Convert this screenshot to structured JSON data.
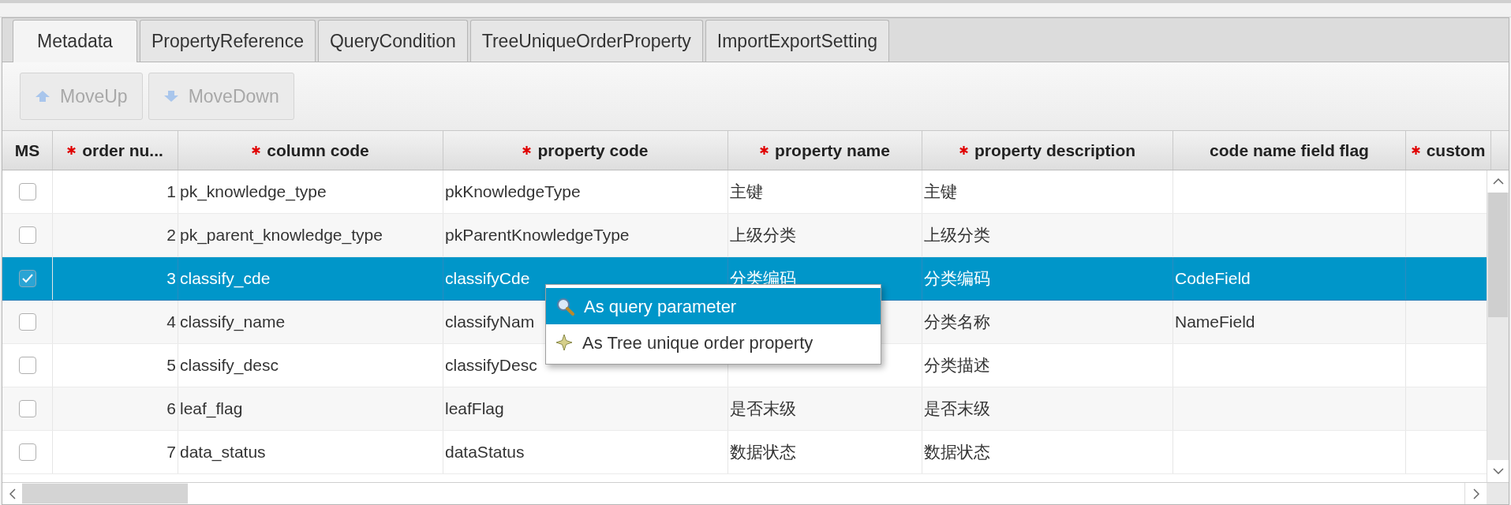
{
  "tabs": [
    {
      "label": "Metadata",
      "selected": true
    },
    {
      "label": "PropertyReference",
      "selected": false
    },
    {
      "label": "QueryCondition",
      "selected": false
    },
    {
      "label": "TreeUniqueOrderProperty",
      "selected": false
    },
    {
      "label": "ImportExportSetting",
      "selected": false
    }
  ],
  "toolbar": [
    {
      "label": "MoveUp",
      "kind": "up",
      "disabled": true
    },
    {
      "label": "MoveDown",
      "kind": "down",
      "disabled": true
    }
  ],
  "table": {
    "columns": [
      {
        "label": "MS",
        "required": false
      },
      {
        "label": "order nu...",
        "required": true
      },
      {
        "label": "column code",
        "required": true
      },
      {
        "label": "property code",
        "required": true
      },
      {
        "label": "property name",
        "required": true
      },
      {
        "label": "property description",
        "required": true
      },
      {
        "label": "code name field flag",
        "required": false
      },
      {
        "label": "custom",
        "required": true
      }
    ],
    "rows": [
      {
        "selected": false,
        "checked": false,
        "order": "1",
        "column_code": "pk_knowledge_type",
        "property_code": "pkKnowledgeType",
        "property_name": "主键",
        "property_description": "主键"
      },
      {
        "selected": false,
        "checked": false,
        "order": "2",
        "column_code": "pk_parent_knowledge_type",
        "property_code": "pkParentKnowledgeType",
        "property_name": "上级分类",
        "property_description": "上级分类"
      },
      {
        "selected": true,
        "checked": true,
        "order": "3",
        "column_code": "classify_cde",
        "property_code": "classifyCde",
        "property_name": "分类编码",
        "property_description": "分类编码",
        "code_name_field_flag": "CodeField"
      },
      {
        "selected": false,
        "checked": false,
        "order": "4",
        "column_code": "classify_name",
        "property_code": "classifyNam",
        "property_description": "分类名称",
        "code_name_field_flag": "NameField"
      },
      {
        "selected": false,
        "checked": false,
        "order": "5",
        "column_code": "classify_desc",
        "property_code": "classifyDesc",
        "property_description": "分类描述"
      },
      {
        "selected": false,
        "checked": false,
        "order": "6",
        "column_code": "leaf_flag",
        "property_code": "leafFlag",
        "property_name": "是否末级",
        "property_description": "是否末级"
      },
      {
        "selected": false,
        "checked": false,
        "order": "7",
        "column_code": "data_status",
        "property_code": "dataStatus",
        "property_name": "数据状态",
        "property_description": "数据状态"
      }
    ]
  },
  "context_menu": {
    "items": [
      {
        "label": "As query parameter",
        "kind": "search",
        "selected": true
      },
      {
        "label": "As Tree unique order property",
        "kind": "star",
        "selected": false
      }
    ]
  }
}
